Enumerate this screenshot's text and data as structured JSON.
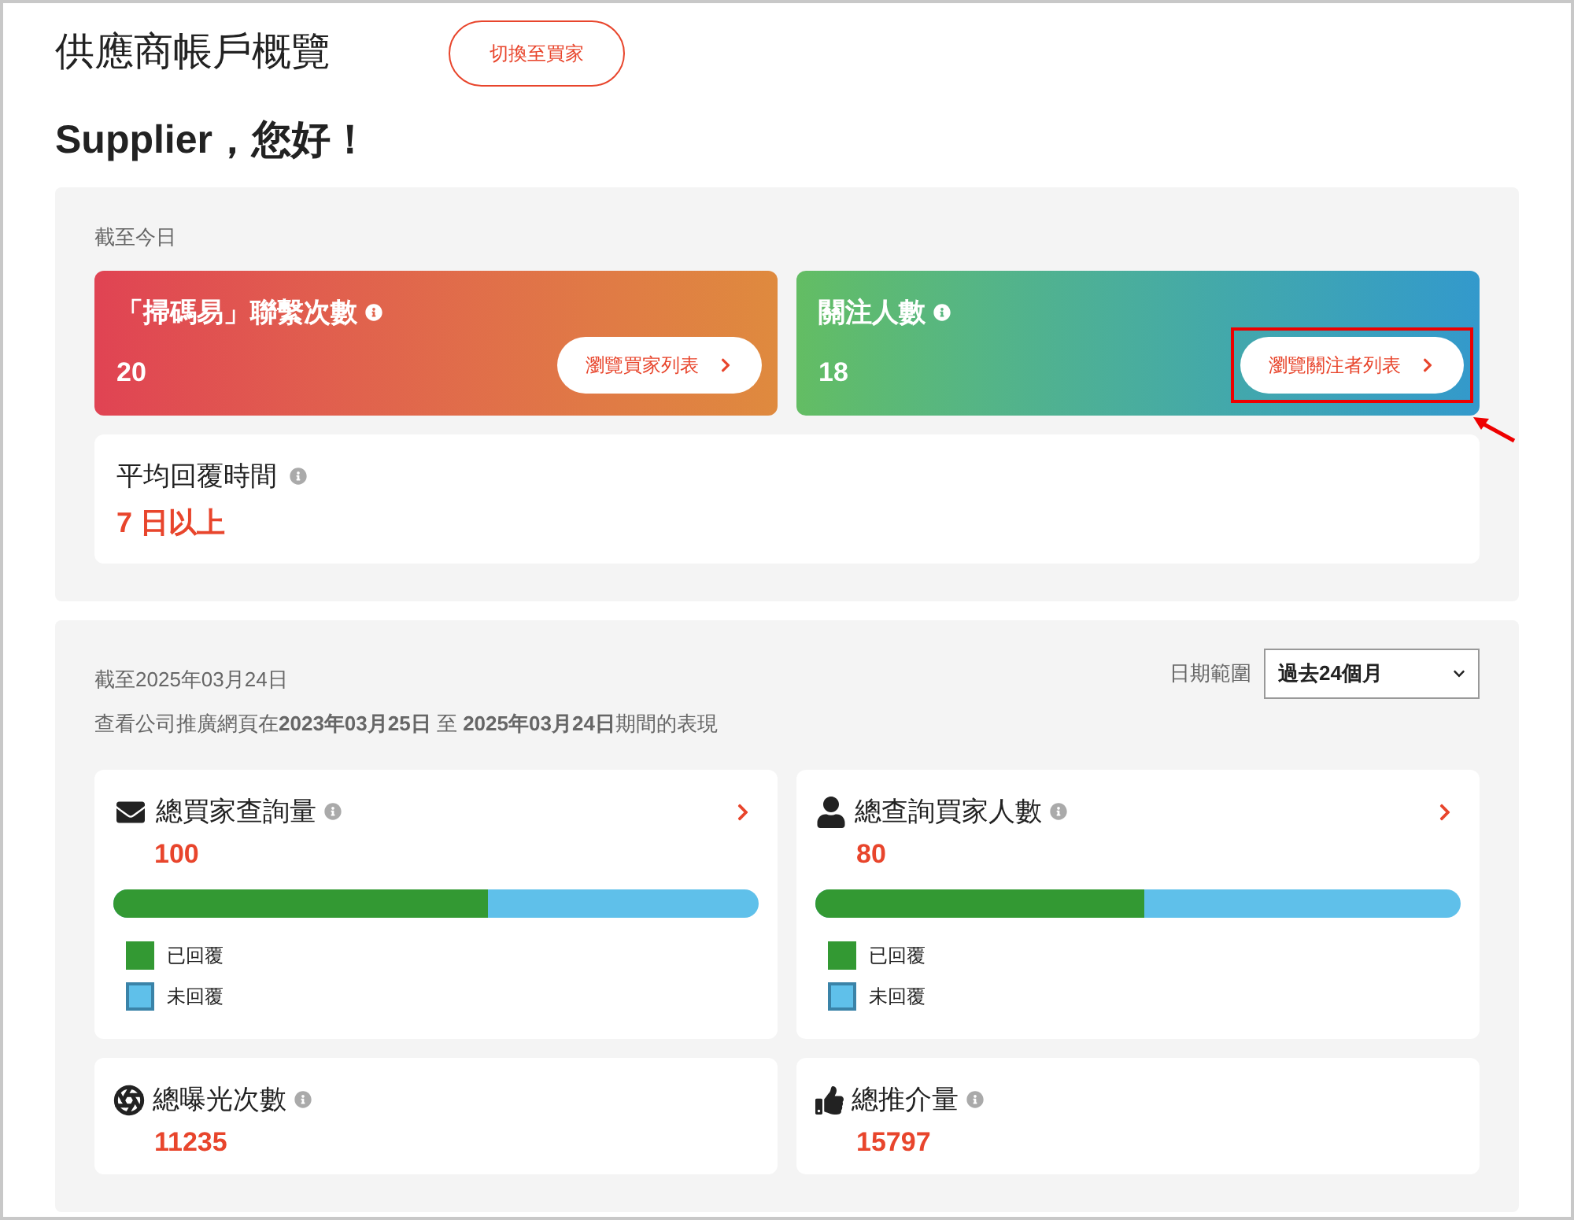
{
  "header": {
    "title": "供應商帳戶概覽",
    "switch_button": "切換至買家"
  },
  "greeting": "Supplier，您好！",
  "today_panel": {
    "caption": "截至今日",
    "cards": [
      {
        "title": "「掃碼易」聯繫次數",
        "value": "20",
        "button": "瀏覽買家列表",
        "highlighted": false
      },
      {
        "title": "關注人數",
        "value": "18",
        "button": "瀏覽關注者列表",
        "highlighted": true
      }
    ],
    "reply_time": {
      "title": "平均回覆時間",
      "value": "7 日以上"
    }
  },
  "period_panel": {
    "caption": "截至2025年03月24日",
    "range_label": "日期範圍",
    "range_value": "過去24個月",
    "description": "查看公司推廣網頁在**2023年03月25日** 至 **2025年03月24日**期間的表現",
    "metrics": [
      {
        "kind": "bar",
        "title": "總買家查詢量",
        "value": "100",
        "level": 0.58,
        "legend": [
          "已回覆",
          "未回覆"
        ]
      },
      {
        "kind": "bar",
        "title": "總查詢買家人數",
        "value": "80",
        "level": 0.51,
        "legend": [
          "已回覆",
          "未回覆"
        ]
      },
      {
        "kind": "plain",
        "title": "總曝光次數",
        "value": "11235"
      },
      {
        "kind": "plain",
        "title": "總推介量",
        "value": "15797"
      }
    ]
  }
}
